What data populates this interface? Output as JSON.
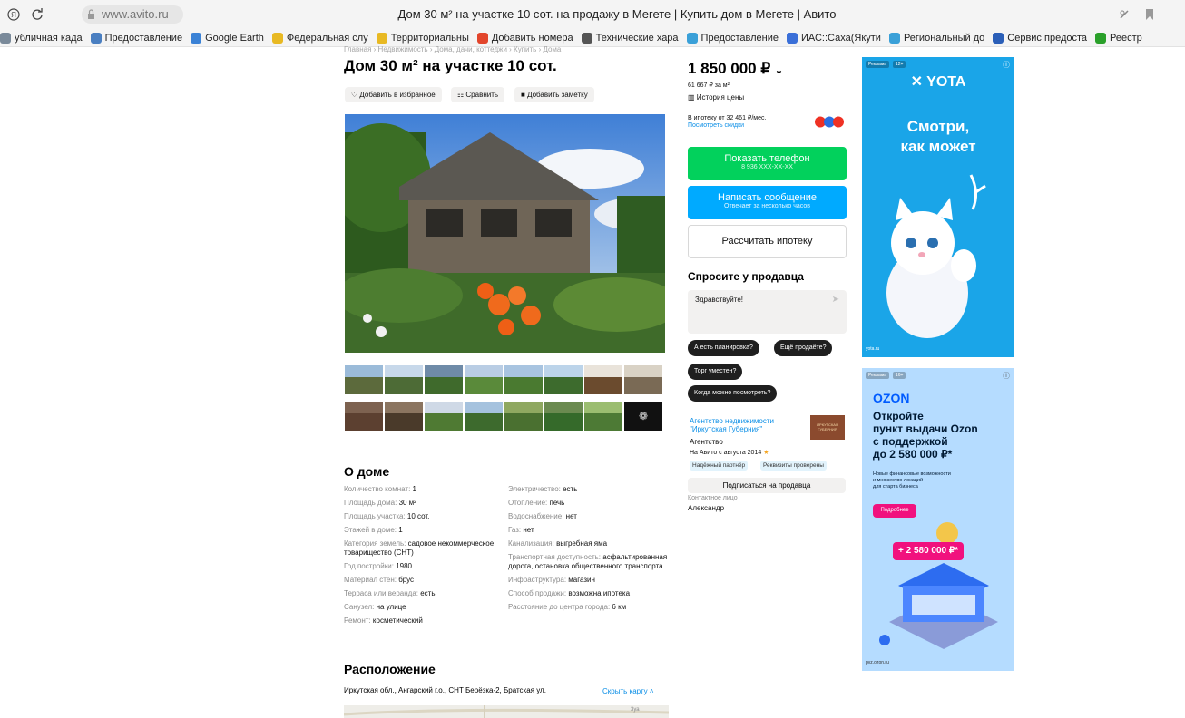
{
  "browser": {
    "url": "www.avito.ru",
    "page_title": "Дом 30 м² на участке 10 сот. на продажу в Мегете | Купить дом в Мегете | Авито",
    "bookmarks": [
      {
        "label": "убличная када",
        "color": "#7a8a9a"
      },
      {
        "label": "Предоставление",
        "color": "#4a7fc1"
      },
      {
        "label": "Google Earth",
        "color": "#3b82d6"
      },
      {
        "label": "Федеральная слу",
        "color": "#e8b923"
      },
      {
        "label": "Территориальны",
        "color": "#e8b923"
      },
      {
        "label": "Добавить номера",
        "color": "#e2452b"
      },
      {
        "label": "Технические хара",
        "color": "#555555"
      },
      {
        "label": "Предоставление",
        "color": "#3aa0d8"
      },
      {
        "label": "ИАС::Саха(Якути",
        "color": "#3a6fd8"
      },
      {
        "label": "Региональный до",
        "color": "#3aa0d8"
      },
      {
        "label": "Сервис предоста",
        "color": "#2b5fb8"
      },
      {
        "label": "Реестр",
        "color": "#2aa02a"
      }
    ]
  },
  "breadcrumbs": "Главная › Недвижимость › Дома, дачи, коттеджи › Купить › Дома",
  "title": "Дом 30 м² на участке 10 сот.",
  "actions": {
    "favorite": "Добавить в избранное",
    "compare": "Сравнить",
    "note": "Добавить заметку"
  },
  "photos": {
    "more_icon": "more-icon"
  },
  "about": {
    "heading": "О доме",
    "left": [
      {
        "k": "Количество комнат: ",
        "v": "1"
      },
      {
        "k": "Площадь дома: ",
        "v": "30 м²"
      },
      {
        "k": "Площадь участка: ",
        "v": "10 сот."
      },
      {
        "k": "Этажей в доме: ",
        "v": "1"
      },
      {
        "k": "Категория земель: ",
        "v": "садовое некоммерческое товарищество (СНТ)"
      },
      {
        "k": "Год постройки: ",
        "v": "1980"
      },
      {
        "k": "Материал стен: ",
        "v": "брус"
      },
      {
        "k": "Терраса или веранда: ",
        "v": "есть"
      },
      {
        "k": "Санузел: ",
        "v": "на улице"
      },
      {
        "k": "Ремонт: ",
        "v": "косметический"
      }
    ],
    "right": [
      {
        "k": "Электричество: ",
        "v": "есть"
      },
      {
        "k": "Отопление: ",
        "v": "печь"
      },
      {
        "k": "Водоснабжение: ",
        "v": "нет"
      },
      {
        "k": "Газ: ",
        "v": "нет"
      },
      {
        "k": "Канализация: ",
        "v": "выгребная яма"
      },
      {
        "k": "Транспортная доступность: ",
        "v": "асфальтированная дорога, остановка общественного транспорта"
      },
      {
        "k": "Инфраструктура: ",
        "v": "магазин"
      },
      {
        "k": "Способ продажи: ",
        "v": "возможна ипотека"
      },
      {
        "k": "Расстояние до центра города: ",
        "v": "6 км"
      }
    ]
  },
  "location": {
    "heading": "Расположение",
    "address": "Иркутская обл., Ангарский г.о., СНТ Берёзка-2, Братская ул.",
    "toggle_map": "Скрыть карту ˄",
    "map_label": "3уа"
  },
  "price": {
    "value": "1 850 000 ₽",
    "per_m2": "61 667 ₽ за м²",
    "history": "История цены",
    "mortgage": "В ипотеку от 32 461 ₽/мес.",
    "discounts": "Посмотреть скидки"
  },
  "buttons": {
    "phone": "Показать телефон",
    "phone_sub": "8 936 XXX-XX-XX",
    "message": "Написать сообщение",
    "message_sub": "Отвечает за несколько часов",
    "mortgage": "Рассчитать ипотеку"
  },
  "ask": {
    "heading": "Спросите у продавца",
    "placeholder": "Здравствуйте!",
    "chips": [
      "А есть планировка?",
      "Ещё продаёте?",
      "Торг уместен?",
      "Когда можно посмотреть?"
    ]
  },
  "seller": {
    "name_line1": "Агентство недвижимости",
    "name_line2": "\"Иркутская Губерния\"",
    "type": "Агентство",
    "since": "На Авито с августа 2014",
    "tag1": "Надёжный партнёр",
    "tag2": "Реквизиты проверены",
    "subscribe": "Подписаться на продавца",
    "contact_label": "Контактное лицо",
    "contact_name": "Александр",
    "logo_text": "ИРКУТСКАЯ ГУБЕРНИЯ"
  },
  "ads": {
    "yota": {
      "label": "Реклама",
      "age": "12+",
      "brand": "YOTA",
      "text_line1": "Смотри,",
      "text_line2": "как может",
      "domain": "yota.ru"
    },
    "ozon": {
      "label": "Реклама",
      "age": "16+",
      "brand": "OZON",
      "headline_line1": "Откройте",
      "headline_line2": "пункт выдачи Ozon",
      "headline_line3": "с поддержкой",
      "headline_line4": "до 2 580 000 ₽*",
      "body_line1": "Новые финансовые возможности",
      "body_line2": "и множество локаций",
      "body_line3": "для старта бизнеса",
      "cta": "Подробнее",
      "badge": "+ 2 580 000 ₽*",
      "domain": "pvz.ozon.ru"
    }
  },
  "colors": {
    "accent_green": "#02d15c",
    "accent_blue": "#00aaff",
    "link": "#0a8ee6",
    "yota_bg": "#1aa5e8",
    "ozon_blue": "#005bff"
  }
}
